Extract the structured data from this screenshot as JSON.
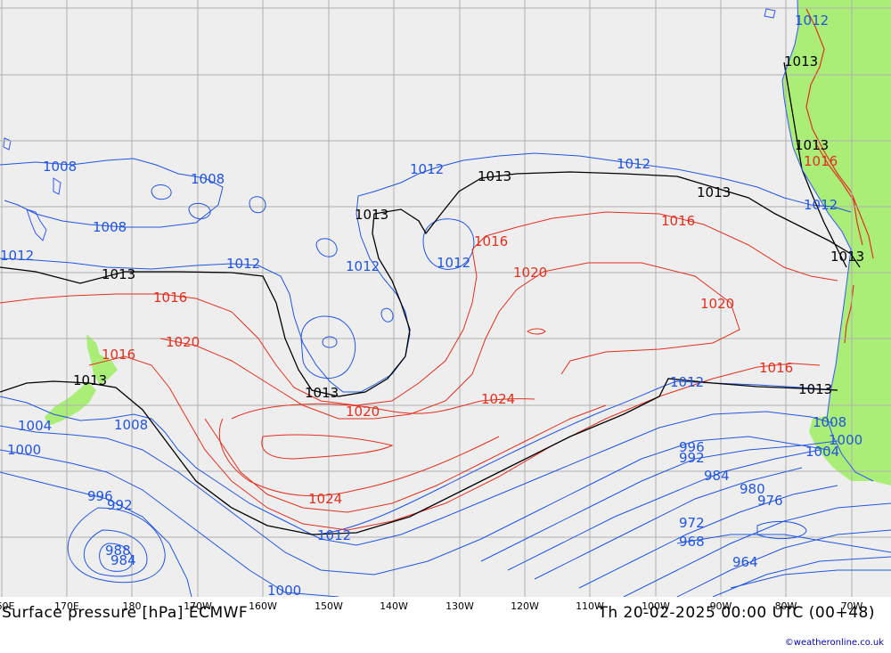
{
  "map": {
    "title": "Surface pressure [hPa] ECMWF",
    "valid_time": "Th 20-02-2025 00:00 UTC (00+48)",
    "credit": "©weatheronline.co.uk",
    "colors": {
      "ocean": "#eeeeee",
      "land": "#aaee77",
      "grid": "#b0b0b0",
      "isobar_low": "#2255dd",
      "isobar_high": "#e03020",
      "isobar_1013": "#000000",
      "coast": "#3355ff"
    },
    "longitude_labels": [
      "60E",
      "170E",
      "180",
      "170W",
      "160W",
      "150W",
      "140W",
      "130W",
      "120W",
      "110W",
      "100W",
      "90W",
      "80W",
      "70W"
    ],
    "isobar_labels": {
      "l1008a": "1008",
      "l1008b": "1008",
      "l1008c": "1008",
      "l1012a": "1012",
      "l1012b": "1012",
      "l1012c": "1012",
      "l1012d": "1012",
      "l1012e": "1012",
      "l1012f": "1012",
      "l1012g": "1012",
      "l1012h": "1012",
      "l1013a": "1013",
      "l1013b": "1013",
      "l1013c": "1013",
      "l1013d": "1013",
      "l1013e": "1013",
      "l1013f": "1013",
      "l1013g": "1013",
      "l1013h": "1013",
      "l1013i": "1013",
      "l1013j": "1013",
      "l1016a": "1016",
      "l1016b": "1016",
      "l1016c": "1016",
      "l1016d": "1016",
      "l1016e": "1016",
      "l1016f": "1016",
      "l1020a": "1020",
      "l1020b": "1020",
      "l1020c": "1020",
      "l1020d": "1020",
      "l1024a": "1024",
      "l1024b": "1024",
      "l1004a": "1004",
      "l1004b": "1004",
      "l1000a": "1000",
      "l1000b": "1000",
      "l1000c": "1000",
      "l1008d": "1008",
      "l1008e": "1008",
      "l996a": "996",
      "l996b": "996",
      "l992a": "992",
      "l992b": "992",
      "l988": "988",
      "l984a": "984",
      "l984b": "984",
      "l980": "980",
      "l976": "976",
      "l972": "972",
      "l968": "968",
      "l964": "964"
    }
  }
}
